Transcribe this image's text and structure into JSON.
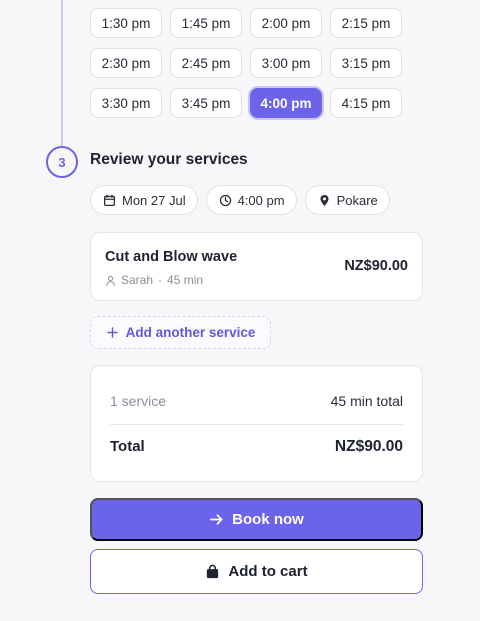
{
  "time_slots": [
    {
      "label": "1:30 pm",
      "selected": false
    },
    {
      "label": "1:45 pm",
      "selected": false
    },
    {
      "label": "2:00 pm",
      "selected": false
    },
    {
      "label": "2:15 pm",
      "selected": false
    },
    {
      "label": "2:30 pm",
      "selected": false
    },
    {
      "label": "2:45 pm",
      "selected": false
    },
    {
      "label": "3:00 pm",
      "selected": false
    },
    {
      "label": "3:15 pm",
      "selected": false
    },
    {
      "label": "3:30 pm",
      "selected": false
    },
    {
      "label": "3:45 pm",
      "selected": false
    },
    {
      "label": "4:00 pm",
      "selected": true
    },
    {
      "label": "4:15 pm",
      "selected": false
    }
  ],
  "step": {
    "number": "3",
    "title": "Review your services"
  },
  "chips": {
    "date": {
      "label": "Mon 27 Jul",
      "icon": "calendar-icon"
    },
    "time": {
      "label": "4:00 pm",
      "icon": "clock-icon"
    },
    "location": {
      "label": "Pokare",
      "icon": "map-pin-icon"
    }
  },
  "service": {
    "name": "Cut and Blow wave",
    "staff": "Sarah",
    "separator": "·",
    "duration": "45 min",
    "price": "NZ$90.00",
    "staff_icon": "person-icon"
  },
  "add_service": {
    "label": "Add another service",
    "icon": "plus-icon"
  },
  "summary": {
    "count": "1 service",
    "duration": "45 min total",
    "total_label": "Total",
    "total_value": "NZ$90.00"
  },
  "actions": {
    "book_now": "Book now",
    "add_to_cart": "Add to cart"
  },
  "colors": {
    "accent": "#6b64ea",
    "background": "#f7f7f9",
    "text": "#1f2230",
    "muted": "#8b8e9a"
  }
}
